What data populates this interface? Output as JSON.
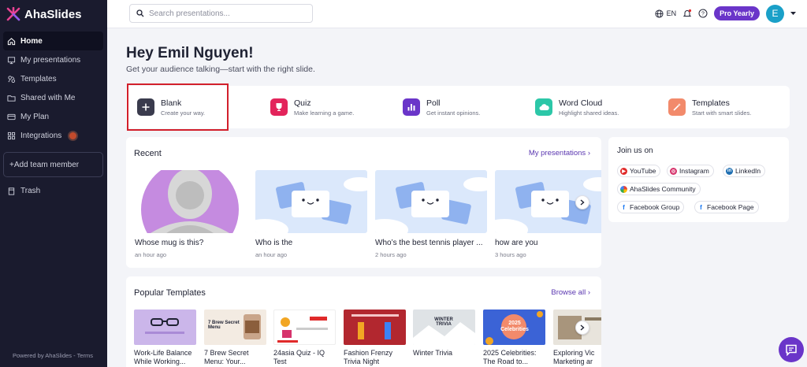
{
  "app": {
    "name": "AhaSlides",
    "powered_by": "Powered by AhaSlides - Terms"
  },
  "search": {
    "placeholder": "Search presentations..."
  },
  "topbar": {
    "language": "EN",
    "plan_label": "Pro Yearly",
    "avatar_initial": "E"
  },
  "sidebar": {
    "items": [
      {
        "label": "Home",
        "icon": "home-icon",
        "active": true
      },
      {
        "label": "My presentations",
        "icon": "presentation-icon"
      },
      {
        "label": "Templates",
        "icon": "templates-icon"
      },
      {
        "label": "Shared with Me",
        "icon": "folder-shared-icon"
      },
      {
        "label": "My Plan",
        "icon": "credit-card-icon"
      },
      {
        "label": "Integrations",
        "icon": "grid-icon"
      }
    ],
    "add_team": "+Add team member",
    "trash": "Trash"
  },
  "greeting": {
    "title": "Hey Emil Nguyen!",
    "subtitle": "Get your audience talking—start with the right slide."
  },
  "quick_actions": [
    {
      "title": "Blank",
      "desc": "Create your way.",
      "color": "#3a3b4d",
      "icon": "plus-icon"
    },
    {
      "title": "Quiz",
      "desc": "Make learning a game.",
      "color": "#e3245b",
      "icon": "trophy-icon"
    },
    {
      "title": "Poll",
      "desc": "Get instant opinions.",
      "color": "#6a35c9",
      "icon": "bar-chart-icon"
    },
    {
      "title": "Word Cloud",
      "desc": "Highlight shared ideas.",
      "color": "#2cc7a8",
      "icon": "cloud-icon"
    },
    {
      "title": "Templates",
      "desc": "Start with smart slides.",
      "color": "#f28a6b",
      "icon": "magic-wand-icon"
    }
  ],
  "recent": {
    "title": "Recent",
    "link": "My presentations",
    "items": [
      {
        "title": "Whose mug is this?",
        "time": "an hour ago"
      },
      {
        "title": "Who is the",
        "time": "an hour ago"
      },
      {
        "title": "Who’s the best tennis player ...",
        "time": "2 hours ago"
      },
      {
        "title": "how are you",
        "time": "3 hours ago"
      }
    ]
  },
  "join": {
    "title": "Join us on",
    "links": [
      {
        "label": "YouTube",
        "color": "#e02a2a"
      },
      {
        "label": "Instagram",
        "color": "#d6336c"
      },
      {
        "label": "LinkedIn",
        "color": "#1f6fb2"
      },
      {
        "label": "AhaSlides Community",
        "color": "#4285f4"
      },
      {
        "label": "Facebook Group",
        "color": "#1877f2"
      },
      {
        "label": "Facebook Page",
        "color": "#1877f2"
      }
    ]
  },
  "popular": {
    "title": "Popular Templates",
    "link": "Browse all",
    "items": [
      {
        "title": "Work-Life Balance While Working..."
      },
      {
        "title": "7 Brew Secret Menu: Your..."
      },
      {
        "title": "24asia Quiz - IQ Test"
      },
      {
        "title": "Fashion Frenzy Trivia Night"
      },
      {
        "title": "Winter Trivia"
      },
      {
        "title": "2025 Celebrities: The Road to..."
      },
      {
        "title": "Exploring Vic Marketing ar"
      }
    ],
    "thumb_texts": {
      "t2": "7 Brew Secret Menu",
      "t5": "WINTER TRIVIA",
      "t6": "2025 Celebrities"
    }
  }
}
